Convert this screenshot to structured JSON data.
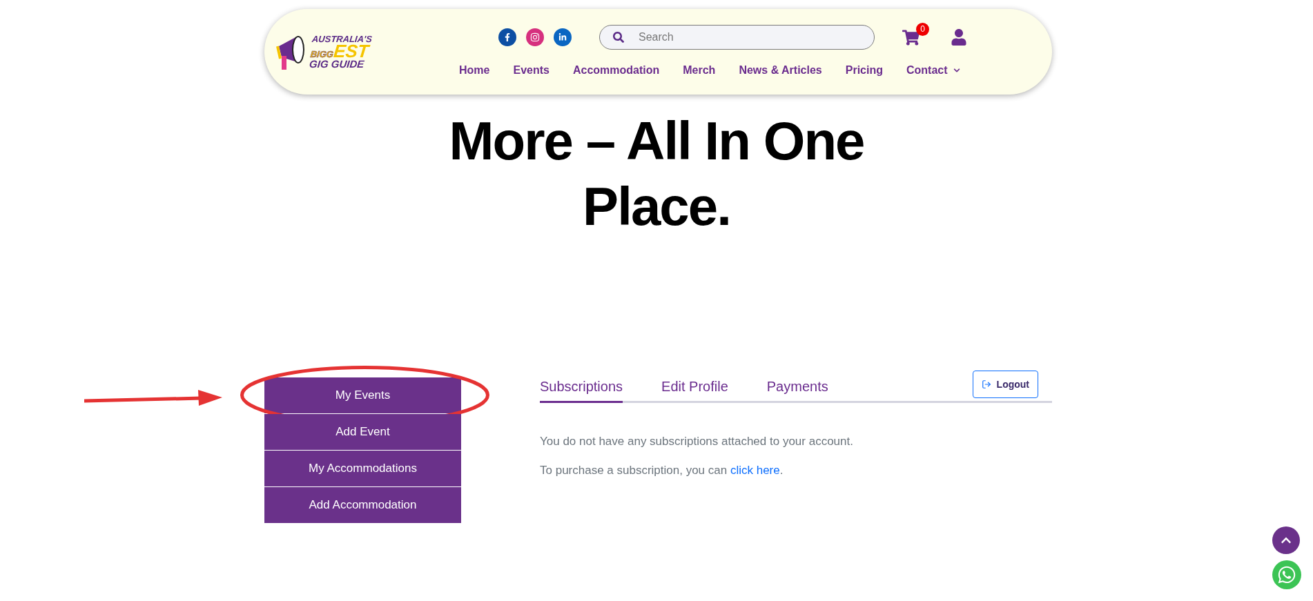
{
  "header": {
    "logo": {
      "lines": [
        "AUSTRALIA'S",
        "BIGG",
        "EST",
        "GIG GUIDE"
      ]
    },
    "social": [
      {
        "kind": "facebook",
        "color": "#0d4fa3"
      },
      {
        "kind": "instagram",
        "color": "#d6307e"
      },
      {
        "kind": "linkedin",
        "color": "#0a66c2"
      }
    ],
    "search": {
      "placeholder": "Search"
    },
    "cart": {
      "count": "0"
    },
    "nav": [
      {
        "label": "Home",
        "has_menu": false
      },
      {
        "label": "Events",
        "has_menu": false
      },
      {
        "label": "Accommodation",
        "has_menu": false
      },
      {
        "label": "Merch",
        "has_menu": false
      },
      {
        "label": "News & Articles",
        "has_menu": false
      },
      {
        "label": "Pricing",
        "has_menu": false
      },
      {
        "label": "Contact",
        "has_menu": true
      }
    ]
  },
  "hero": {
    "lines": [
      "More – All In One",
      "Place."
    ]
  },
  "sidebar": {
    "items": [
      {
        "label": "My Events",
        "circled": true
      },
      {
        "label": "Add Event",
        "circled": false
      },
      {
        "label": "My Accommodations",
        "circled": false
      },
      {
        "label": "Add Accommodation",
        "circled": false
      }
    ]
  },
  "tabs": [
    {
      "label": "Subscriptions",
      "selected": true
    },
    {
      "label": "Edit Profile",
      "selected": false
    },
    {
      "label": "Payments",
      "selected": false
    }
  ],
  "logout": {
    "label": "Logout"
  },
  "messages": [
    {
      "text": "You do not have any subscriptions attached to your account."
    },
    {
      "text": "To purchase a subscription, you can ",
      "link": "click here",
      "after": "."
    }
  ]
}
